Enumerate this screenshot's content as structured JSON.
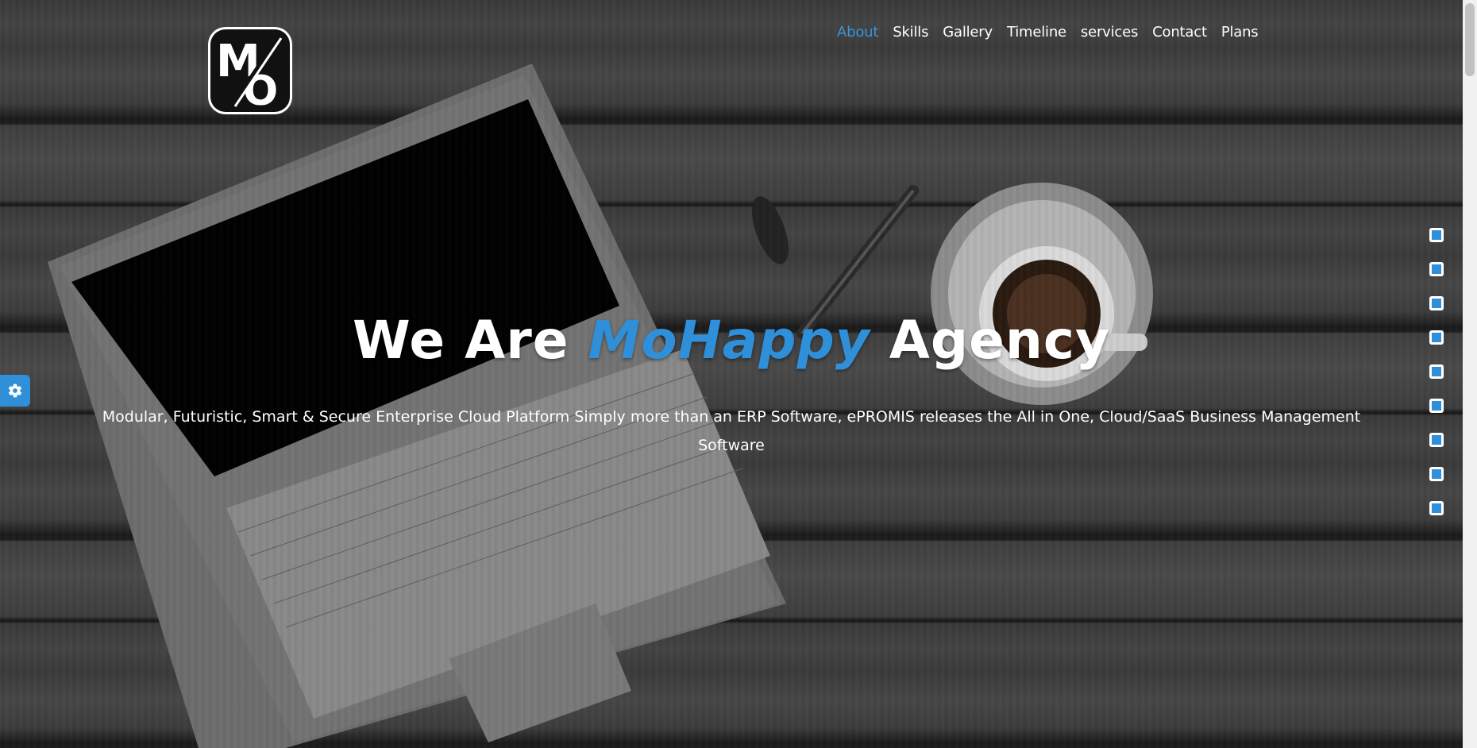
{
  "nav": {
    "items": [
      {
        "label": "About",
        "active": true
      },
      {
        "label": "Skills",
        "active": false
      },
      {
        "label": "Gallery",
        "active": false
      },
      {
        "label": "Timeline",
        "active": false
      },
      {
        "label": "services",
        "active": false
      },
      {
        "label": "Contact",
        "active": false
      },
      {
        "label": "Plans",
        "active": false
      }
    ]
  },
  "logo": {
    "letter_top": "M",
    "letter_bottom": "O"
  },
  "hero": {
    "headline_pre": "We Are ",
    "headline_accent": "MoHappy",
    "headline_post": " Agency",
    "subtitle": "Modular, Futuristic, Smart & Secure Enterprise Cloud Platform Simply more than an ERP Software, ePROMIS releases the All in One, Cloud/SaaS Business Management Software"
  },
  "side_dots": {
    "count": 9
  },
  "settings": {
    "icon": "gear-icon"
  },
  "colors": {
    "accent": "#2f8fd8",
    "text": "#ffffff"
  }
}
